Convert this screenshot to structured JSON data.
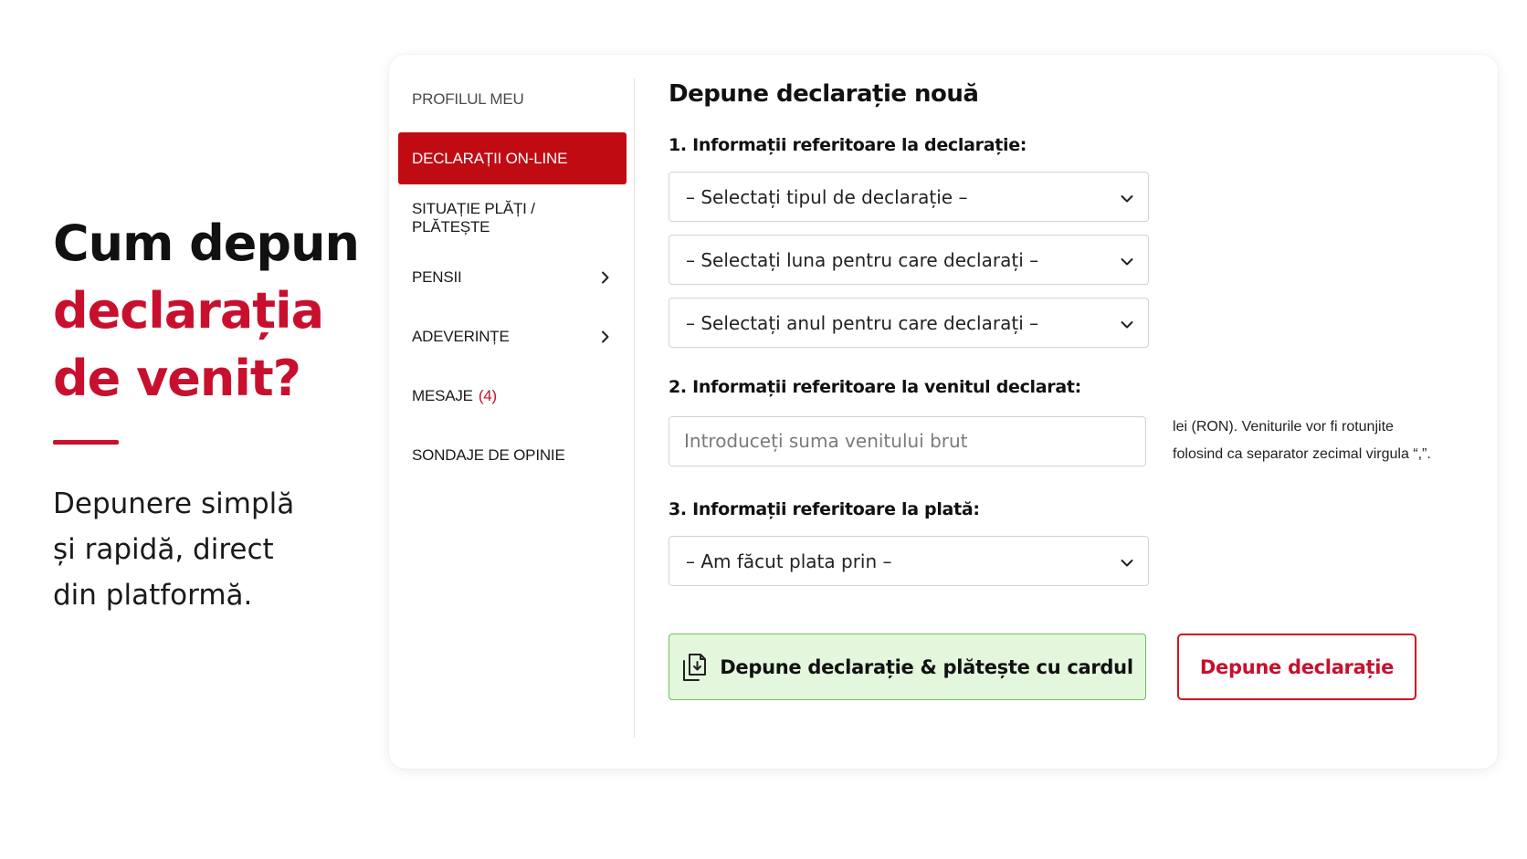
{
  "hero": {
    "title_line1": "Cum depun",
    "title_line2": "declarația",
    "title_line3": "de venit?",
    "subtitle_line1": "Depunere simplă",
    "subtitle_line2": "și rapidă, direct",
    "subtitle_line3": "din platformă."
  },
  "sidebar": {
    "items": [
      {
        "label": "PROFILUL MEU"
      },
      {
        "label": "DECLARAȚII ON-LINE"
      },
      {
        "label": "SITUAȚIE PLĂȚI / PLĂTEȘTE"
      },
      {
        "label": "PENSII"
      },
      {
        "label": "ADEVERINȚE"
      },
      {
        "label": "MESAJE",
        "badge": "(4)"
      },
      {
        "label": "SONDAJE DE OPINIE"
      }
    ]
  },
  "form": {
    "title": "Depune declarație nouă",
    "section1": {
      "title": "1. Informații referitoare la declarație:",
      "type_select": "– Selectați tipul de declarație –",
      "month_select": "– Selectați luna pentru care declarați –",
      "year_select": "– Selectați anul pentru care declarați –"
    },
    "section2": {
      "title": "2. Informații referitoare la venitul declarat:",
      "income_placeholder": "Introduceți suma venitului brut",
      "hint_line1": "lei (RON). Veniturile vor fi rotunjite",
      "hint_line2": "folosind ca separator zecimal virgula “,”."
    },
    "section3": {
      "title": "3. Informații referitoare la plată:",
      "payment_select": "– Am făcut plata prin –"
    },
    "buttons": {
      "submit_pay": "Depune declarație & plătește cu cardul",
      "submit": "Depune declarație"
    }
  },
  "colors": {
    "brand_red": "#c00b13",
    "green_bg": "#e3f7dc",
    "green_border": "#69c15a"
  },
  "icons": {
    "select_arrow": "chevron-down-icon",
    "nav_arrow": "chevron-right-icon",
    "submit_pay": "document-download-icon"
  }
}
